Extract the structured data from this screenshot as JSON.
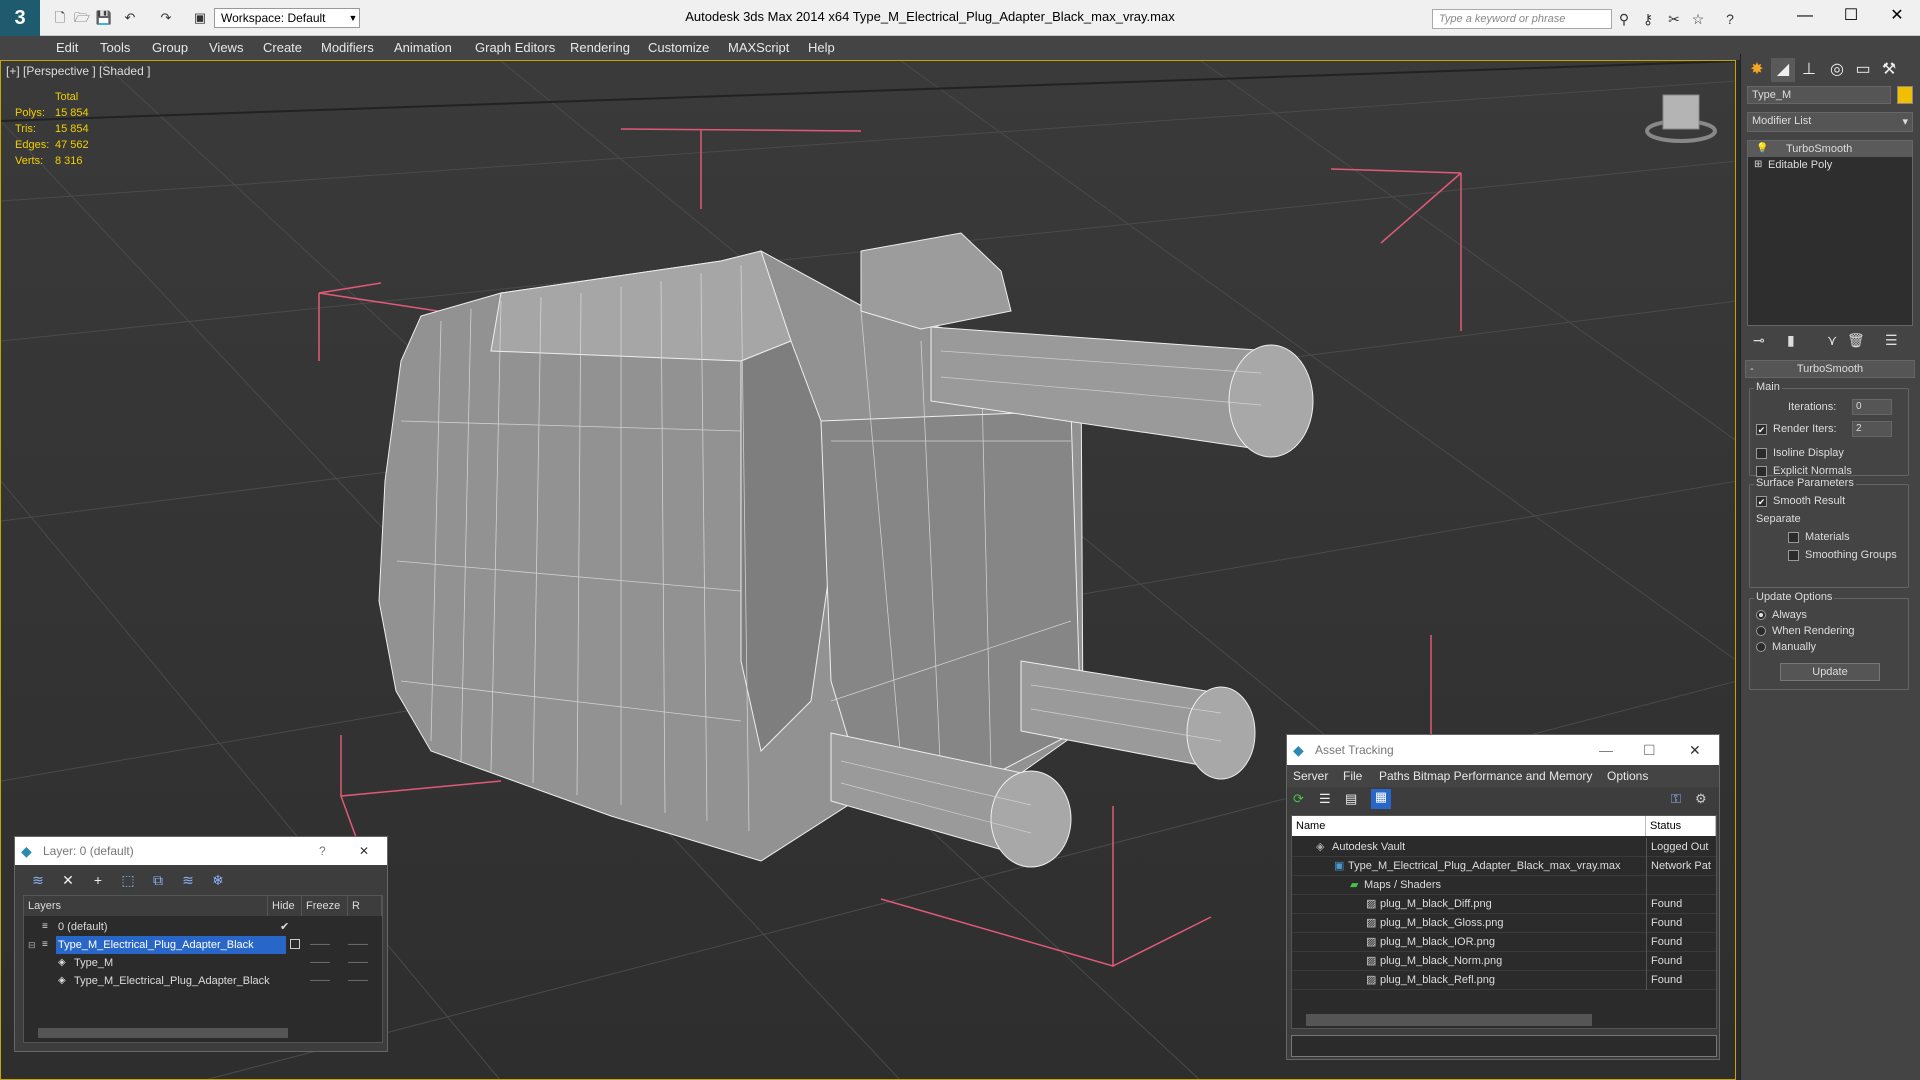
{
  "titlebar": {
    "logo_text": "3",
    "workspace": "Workspace: Default",
    "app_title": "Autodesk 3ds Max  2014 x64      Type_M_Electrical_Plug_Adapter_Black_max_vray.max",
    "search_placeholder": "Type a keyword or phrase",
    "window_buttons": [
      "—",
      "☐",
      "✕"
    ]
  },
  "menu": {
    "items": [
      "Edit",
      "Tools",
      "Group",
      "Views",
      "Create",
      "Modifiers",
      "Animation",
      "Graph Editors",
      "Rendering",
      "Customize",
      "MAXScript",
      "Help"
    ]
  },
  "viewport": {
    "label": "[+] [Perspective ] [Shaded ]",
    "stats": {
      "header": "Total",
      "rows": [
        {
          "label": "Polys:",
          "value": "15 854"
        },
        {
          "label": "Tris:",
          "value": "15 854"
        },
        {
          "label": "Edges:",
          "value": "47 562"
        },
        {
          "label": "Verts:",
          "value": "8 316"
        }
      ]
    }
  },
  "command_panel": {
    "object_name": "Type_M",
    "object_color": "#f0c000",
    "modifier_list_label": "Modifier List",
    "stack": [
      "TurboSmooth",
      "Editable Poly"
    ],
    "rollout_title": "TurboSmooth",
    "main_group": "Main",
    "iterations_label": "Iterations:",
    "iterations_value": "0",
    "render_iters_label": "Render Iters:",
    "render_iters_value": "2",
    "isoline_label": "Isoline Display",
    "explicit_normals_label": "Explicit Normals",
    "surface_group": "Surface Parameters",
    "smooth_result_label": "Smooth Result",
    "separate_label": "Separate",
    "materials_label": "Materials",
    "smoothing_groups_label": "Smoothing Groups",
    "update_group": "Update Options",
    "always_label": "Always",
    "when_rendering_label": "When Rendering",
    "manually_label": "Manually",
    "update_button": "Update"
  },
  "layer_dialog": {
    "title": "Layer: 0 (default)",
    "help": "?",
    "close": "✕",
    "columns": [
      "Layers",
      "Hide",
      "Freeze",
      "R"
    ],
    "rows": [
      {
        "name": "0 (default)",
        "selected": false,
        "indent": 1
      },
      {
        "name": "Type_M_Electrical_Plug_Adapter_Black",
        "selected": true,
        "indent": 1
      },
      {
        "name": "Type_M",
        "selected": false,
        "indent": 2
      },
      {
        "name": "Type_M_Electrical_Plug_Adapter_Black",
        "selected": false,
        "indent": 2
      }
    ]
  },
  "asset_dialog": {
    "title": "Asset Tracking",
    "menu": [
      "Server",
      "File",
      "Paths",
      "Bitmap Performance and Memory",
      "Options"
    ],
    "columns": [
      "Name",
      "Status"
    ],
    "rows": [
      {
        "name": "Autodesk Vault",
        "status": "Logged Out"
      },
      {
        "name": "Type_M_Electrical_Plug_Adapter_Black_max_vray.max",
        "status": "Network Pat"
      },
      {
        "name": "Maps / Shaders",
        "status": ""
      },
      {
        "name": "plug_M_black_Diff.png",
        "status": "Found"
      },
      {
        "name": "plug_M_black_Gloss.png",
        "status": "Found"
      },
      {
        "name": "plug_M_black_IOR.png",
        "status": "Found"
      },
      {
        "name": "plug_M_black_Norm.png",
        "status": "Found"
      },
      {
        "name": "plug_M_black_Refl.png",
        "status": "Found"
      }
    ]
  }
}
